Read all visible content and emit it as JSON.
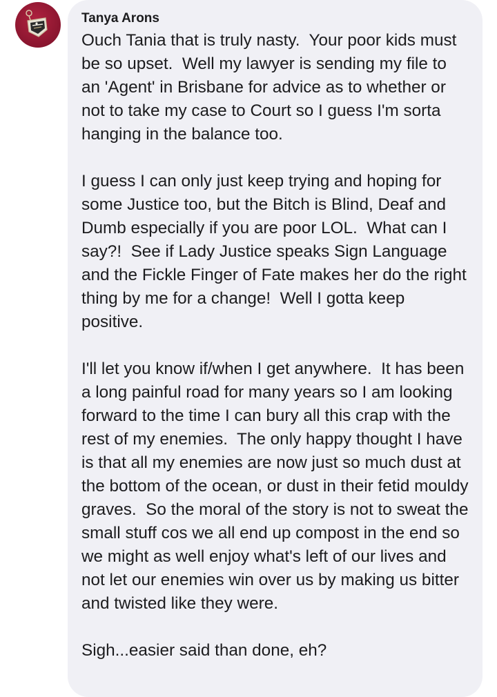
{
  "comment": {
    "author": "Tanya Arons",
    "paragraphs": [
      "Ouch Tania that is truly nasty.  Your poor kids must be so upset.  Well my lawyer is sending my file to an 'Agent' in Brisbane for advice as to whether or not to take my case to Court so I guess I'm sorta hanging in the balance too.",
      "I guess I can only just keep trying and hoping for some Justice too, but the Bitch is Blind, Deaf and Dumb especially if you are poor LOL.  What can I say?!  See if Lady Justice speaks Sign Language and the Fickle Finger of Fate makes her do the right thing by me for a change!  Well I gotta keep positive.",
      "I'll let you know if/when I get anywhere.  It has been a long painful road for many years so I am looking forward to the time I can bury all this crap with the rest of my enemies.  The only happy thought I have is that all my enemies are now just so much dust at the bottom of the ocean, or dust in their fetid mouldy graves.  So the moral of the story is not to sweat the small stuff cos we all end up compost in the end so we might as well enjoy what's left of our lives and not let our enemies win over us by making us bitter and twisted like they were.",
      "Sigh...easier said than done, eh?"
    ]
  },
  "avatar": {
    "icon": "pendant-charm-icon",
    "background_color": "#8f1731"
  },
  "colors": {
    "bubble_background": "#f0f0f5",
    "text": "#1c1c1e"
  }
}
